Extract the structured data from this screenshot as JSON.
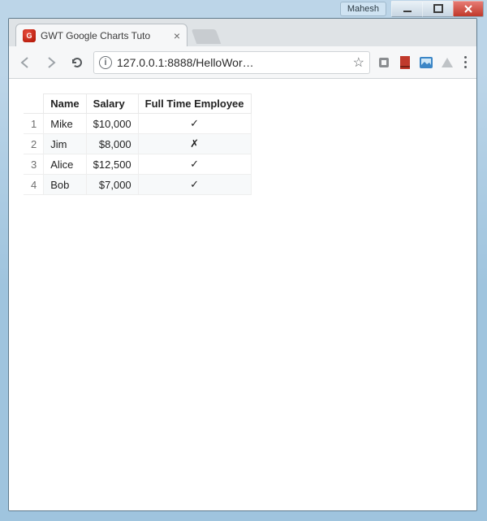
{
  "window": {
    "user_label": "Mahesh"
  },
  "browser": {
    "tab_title": "GWT Google Charts Tuto",
    "url_display": "127.0.0.1:8888/HelloWor…",
    "favicon_letter": "G"
  },
  "chart_data": {
    "type": "table",
    "columns": [
      "Name",
      "Salary",
      "Full Time Employee"
    ],
    "rows": [
      {
        "n": "1",
        "name": "Mike",
        "salary": "$10,000",
        "fte": "✓"
      },
      {
        "n": "2",
        "name": "Jim",
        "salary": "$8,000",
        "fte": "✗"
      },
      {
        "n": "3",
        "name": "Alice",
        "salary": "$12,500",
        "fte": "✓"
      },
      {
        "n": "4",
        "name": "Bob",
        "salary": "$7,000",
        "fte": "✓"
      }
    ]
  }
}
